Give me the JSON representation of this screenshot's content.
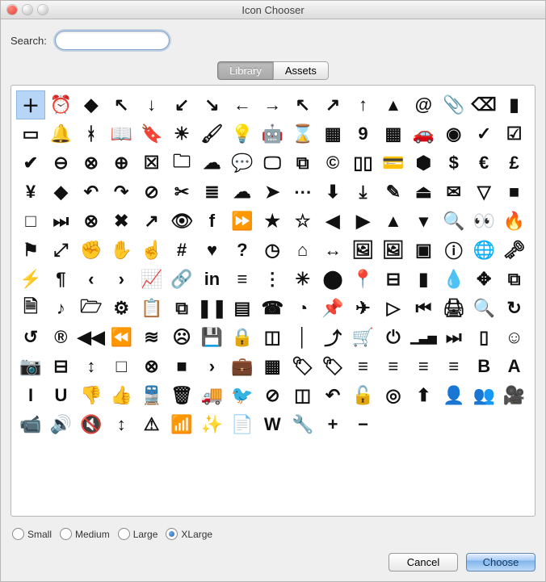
{
  "window": {
    "title": "Icon Chooser"
  },
  "search": {
    "label": "Search:",
    "value": "",
    "placeholder": ""
  },
  "tabs": [
    {
      "label": "Library",
      "active": true
    },
    {
      "label": "Assets",
      "active": false
    }
  ],
  "sizes": {
    "options": [
      {
        "label": "Small",
        "value": "s",
        "selected": false
      },
      {
        "label": "Medium",
        "value": "m",
        "selected": false
      },
      {
        "label": "Large",
        "value": "l",
        "selected": false
      },
      {
        "label": "XLarge",
        "value": "xl",
        "selected": true
      }
    ]
  },
  "buttons": {
    "cancel": "Cancel",
    "choose": "Choose"
  },
  "icons": [
    "plus-icon",
    "alarm-icon",
    "apple-icon",
    "cursor-arrow-icon",
    "arrow-down-icon",
    "arrow-down-left-icon",
    "arrow-down-right-icon",
    "arrow-left-icon",
    "arrow-right-icon",
    "arrow-up-left-icon",
    "arrow-up-right-icon",
    "arrow-up-icon",
    "caret-up-icon",
    "at-sign-icon",
    "paperclip-icon",
    "backspace-icon",
    "bar-chart-icon",
    "battery-icon",
    "bell-icon",
    "bluetooth-icon",
    "book-open-icon",
    "bookmark-icon",
    "brightness-icon",
    "paint-brush-icon",
    "lightbulb-icon",
    "android-icon",
    "hourglass-icon",
    "calculator-icon",
    "calendar-day-icon",
    "calendar-month-icon",
    "car-icon",
    "disc-icon",
    "check-icon",
    "checkbox-checked-icon",
    "circle-check-icon",
    "circle-minus-icon",
    "circle-x-icon",
    "circle-plus-icon",
    "x-square-icon",
    "folder-closed-icon",
    "cloud-filled-icon",
    "comments-icon",
    "monitor-icon",
    "copy-icon",
    "copyright-icon",
    "columns-icon",
    "credit-card-icon",
    "cube-icon",
    "dollar-icon",
    "euro-icon",
    "pound-icon",
    "yen-icon",
    "diamond-icon",
    "undo-icon",
    "redo-icon",
    "do-not-enter-icon",
    "scissors-icon",
    "database-icon",
    "download-cloud-icon",
    "navigation-cursor-icon",
    "ellipsis-icon",
    "circle-arrow-down-icon",
    "download-icon",
    "pencil-edit-icon",
    "eject-icon",
    "envelope-icon",
    "triangle-down-outline-icon",
    "stop-square-icon",
    "stop-square-outline-icon",
    "step-forward-icon",
    "circle-x-outline-icon",
    "document-x-icon",
    "external-link-icon",
    "eye-icon",
    "facebook-icon",
    "fast-forward-icon",
    "star-filled-icon",
    "star-outline-icon",
    "caret-left-icon",
    "play-icon",
    "triangle-up-icon",
    "filter-funnel-icon",
    "magnifier-icon",
    "binoculars-icon",
    "flame-icon",
    "flag-icon",
    "expand-corners-icon",
    "hand-grab-icon",
    "hand-open-icon",
    "hand-pointer-icon",
    "hash-icon",
    "heart-icon",
    "circle-question-icon",
    "circle-clock-icon",
    "home-icon",
    "resize-horizontal-icon",
    "image-icon",
    "image-export-icon",
    "stop-outline-icon",
    "info-icon",
    "globe-icon",
    "key-icon",
    "lightning-icon",
    "paragraph-icon",
    "chevron-left-icon",
    "chevron-right-icon",
    "line-chart-icon",
    "link-icon",
    "linkedin-icon",
    "list-icon",
    "list-numbered-icon",
    "spinner-icon",
    "map-pin-icon",
    "map-marker-icon",
    "minus-square-icon",
    "mobile-icon",
    "dropper-icon",
    "move-icon",
    "sitemap-icon",
    "new-document-icon",
    "music-note-icon",
    "folder-open-icon",
    "gear-icon",
    "clipboard-icon",
    "duplicate-icon-outline",
    "pause-icon",
    "pdf-icon",
    "phone-icon",
    "pie-chart-icon",
    "pushpin-icon",
    "airplane-icon",
    "play-outline-icon",
    "skip-back-icon",
    "printer-icon",
    "print-preview-icon",
    "rotate-cw-icon",
    "rotate-ccw-icon",
    "registered-icon",
    "rewind-alt-icon",
    "rewind-icon",
    "rss-icon",
    "sad-face-icon",
    "save-floppy-icon",
    "lock-icon",
    "user-card-icon",
    "pipe-icon",
    "share-nodes-icon",
    "shopping-cart-icon",
    "power-icon",
    "signal-bars-icon",
    "skip-forward-icon",
    "smartphone-outline-icon",
    "smile-face-icon",
    "camera-icon",
    "collapse-icon",
    "sort-icon",
    "square-outline-icon",
    "circle-x-bold-icon",
    "square-filled-icon",
    "chevron-right-bold-icon",
    "briefcase-icon",
    "grid-icon",
    "tag-icon",
    "tag-remove-icon",
    "align-justify-icon",
    "align-left-icon",
    "align-center-icon",
    "align-right-icon",
    "bold-icon",
    "font-icon",
    "italic-icon",
    "underline-icon",
    "thumbs-down-icon",
    "thumbs-up-icon",
    "train-icon",
    "trash-icon",
    "truck-icon",
    "twitter-icon",
    "ban-icon",
    "window-icon",
    "undo-curved-icon",
    "unlock-icon",
    "target-icon",
    "circle-arrow-up-icon",
    "user-icon",
    "users-icon",
    "video-camera-icon",
    "video-recorder-icon",
    "volume-icon",
    "volume-mute-icon",
    "resize-vertical-icon",
    "warning-triangle-icon",
    "wifi-icon",
    "magic-wand-icon",
    "document-export-icon",
    "word-icon",
    "wrench-icon",
    "zoom-in-icon",
    "zoom-out-icon"
  ],
  "selected_icon_index": 0,
  "glyph_map": {
    "plus-icon": "＋",
    "alarm-icon": "⏰",
    "apple-icon": "",
    "cursor-arrow-icon": "↖",
    "arrow-down-icon": "↓",
    "arrow-down-left-icon": "↙",
    "arrow-down-right-icon": "↘",
    "arrow-left-icon": "←",
    "arrow-right-icon": "→",
    "arrow-up-left-icon": "↖",
    "arrow-up-right-icon": "↗",
    "arrow-up-icon": "↑",
    "caret-up-icon": "▴",
    "at-sign-icon": "@",
    "paperclip-icon": "📎",
    "backspace-icon": "⌫",
    "bar-chart-icon": "▮",
    "battery-icon": "▭",
    "bell-icon": "🔔",
    "bluetooth-icon": "ᚼ",
    "book-open-icon": "📖",
    "bookmark-icon": "🔖",
    "brightness-icon": "☀",
    "paint-brush-icon": "🖌",
    "lightbulb-icon": "💡",
    "android-icon": "🤖",
    "hourglass-icon": "⌛",
    "calculator-icon": "▦",
    "calendar-day-icon": "9",
    "calendar-month-icon": "▦",
    "car-icon": "🚗",
    "disc-icon": "◉",
    "check-icon": "✓",
    "checkbox-checked-icon": "☑",
    "circle-check-icon": "✔",
    "circle-minus-icon": "⊖",
    "circle-x-icon": "⊗",
    "circle-plus-icon": "⊕",
    "x-square-icon": "☒",
    "folder-closed-icon": "🗀",
    "cloud-filled-icon": "☁",
    "comments-icon": "💬",
    "monitor-icon": "🖵",
    "copy-icon": "⧉",
    "copyright-icon": "©",
    "columns-icon": "▯▯",
    "credit-card-icon": "💳",
    "cube-icon": "⬢",
    "dollar-icon": "$",
    "euro-icon": "€",
    "pound-icon": "£",
    "yen-icon": "¥",
    "diamond-icon": "◆",
    "undo-icon": "↶",
    "redo-icon": "↷",
    "do-not-enter-icon": "⊘",
    "scissors-icon": "✂",
    "database-icon": "≣",
    "download-cloud-icon": "☁",
    "navigation-cursor-icon": "➤",
    "ellipsis-icon": "⋯",
    "circle-arrow-down-icon": "⬇",
    "download-icon": "⤓",
    "pencil-edit-icon": "✎",
    "eject-icon": "⏏",
    "envelope-icon": "✉",
    "triangle-down-outline-icon": "▽",
    "stop-square-icon": "■",
    "stop-square-outline-icon": "□",
    "step-forward-icon": "⏭",
    "circle-x-outline-icon": "⊗",
    "document-x-icon": "✖",
    "external-link-icon": "↗",
    "eye-icon": "👁",
    "facebook-icon": "f",
    "fast-forward-icon": "⏩",
    "star-filled-icon": "★",
    "star-outline-icon": "☆",
    "caret-left-icon": "◀",
    "play-icon": "▶",
    "triangle-up-icon": "▲",
    "filter-funnel-icon": "▾",
    "magnifier-icon": "🔍",
    "binoculars-icon": "👀",
    "flame-icon": "🔥",
    "flag-icon": "⚑",
    "expand-corners-icon": "⤢",
    "hand-grab-icon": "✊",
    "hand-open-icon": "✋",
    "hand-pointer-icon": "☝",
    "hash-icon": "#",
    "heart-icon": "♥",
    "circle-question-icon": "?",
    "circle-clock-icon": "◷",
    "home-icon": "⌂",
    "resize-horizontal-icon": "↔",
    "image-icon": "🖼",
    "image-export-icon": "🖼",
    "stop-outline-icon": "▣",
    "info-icon": "ⓘ",
    "globe-icon": "🌐",
    "key-icon": "🗝",
    "lightning-icon": "⚡",
    "paragraph-icon": "¶",
    "chevron-left-icon": "‹",
    "chevron-right-icon": "›",
    "line-chart-icon": "📈",
    "link-icon": "🔗",
    "linkedin-icon": "in",
    "list-icon": "≡",
    "list-numbered-icon": "⋮",
    "spinner-icon": "✳",
    "map-pin-icon": "⬤",
    "map-marker-icon": "📍",
    "minus-square-icon": "⊟",
    "mobile-icon": "▮",
    "dropper-icon": "💧",
    "move-icon": "✥",
    "sitemap-icon": "⧉",
    "new-document-icon": "🗎",
    "music-note-icon": "♪",
    "folder-open-icon": "🗁",
    "gear-icon": "⚙",
    "clipboard-icon": "📋",
    "duplicate-icon-outline": "⧉",
    "pause-icon": "❚❚",
    "pdf-icon": "▤",
    "phone-icon": "☎",
    "pie-chart-icon": "◔",
    "pushpin-icon": "📌",
    "airplane-icon": "✈",
    "play-outline-icon": "▷",
    "skip-back-icon": "⏮",
    "printer-icon": "🖨",
    "print-preview-icon": "🔍",
    "rotate-cw-icon": "↻",
    "rotate-ccw-icon": "↺",
    "registered-icon": "®",
    "rewind-alt-icon": "◀◀",
    "rewind-icon": "⏪",
    "rss-icon": "≋",
    "sad-face-icon": "☹",
    "save-floppy-icon": "💾",
    "lock-icon": "🔒",
    "user-card-icon": "◫",
    "pipe-icon": "│",
    "share-nodes-icon": "⤴",
    "shopping-cart-icon": "🛒",
    "power-icon": "⏻",
    "signal-bars-icon": "▁▃▅",
    "skip-forward-icon": "⏭",
    "smartphone-outline-icon": "▯",
    "smile-face-icon": "☺",
    "camera-icon": "📷",
    "collapse-icon": "⊟",
    "sort-icon": "↕",
    "square-outline-icon": "□",
    "circle-x-bold-icon": "⊗",
    "square-filled-icon": "■",
    "chevron-right-bold-icon": "›",
    "briefcase-icon": "💼",
    "grid-icon": "▦",
    "tag-icon": "🏷",
    "tag-remove-icon": "🏷",
    "align-justify-icon": "≡",
    "align-left-icon": "≡",
    "align-center-icon": "≡",
    "align-right-icon": "≡",
    "bold-icon": "B",
    "font-icon": "A",
    "italic-icon": "I",
    "underline-icon": "U",
    "thumbs-down-icon": "👎",
    "thumbs-up-icon": "👍",
    "train-icon": "🚆",
    "trash-icon": "🗑",
    "truck-icon": "🚚",
    "twitter-icon": "🐦",
    "ban-icon": "⊘",
    "window-icon": "◫",
    "undo-curved-icon": "↶",
    "unlock-icon": "🔓",
    "target-icon": "◎",
    "circle-arrow-up-icon": "⬆",
    "user-icon": "👤",
    "users-icon": "👥",
    "video-camera-icon": "🎥",
    "video-recorder-icon": "📹",
    "volume-icon": "🔊",
    "volume-mute-icon": "🔇",
    "resize-vertical-icon": "↕",
    "warning-triangle-icon": "⚠",
    "wifi-icon": "📶",
    "magic-wand-icon": "✨",
    "document-export-icon": "📄",
    "word-icon": "W",
    "wrench-icon": "🔧",
    "zoom-in-icon": "+",
    "zoom-out-icon": "−"
  }
}
